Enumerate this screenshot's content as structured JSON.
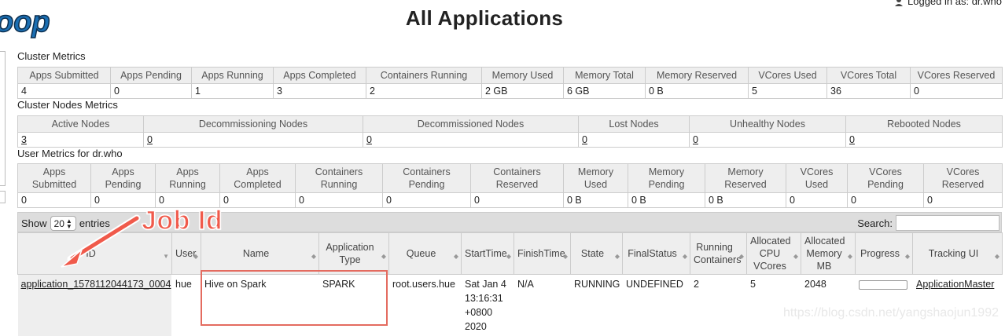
{
  "header": {
    "logo_text": "oop",
    "title": "All Applications",
    "logged_in": "Logged in as: dr.who"
  },
  "cluster_metrics": {
    "title": "Cluster Metrics",
    "headers": [
      "Apps Submitted",
      "Apps Pending",
      "Apps Running",
      "Apps Completed",
      "Containers Running",
      "Memory Used",
      "Memory Total",
      "Memory Reserved",
      "VCores Used",
      "VCores Total",
      "VCores Reserved"
    ],
    "values": [
      "4",
      "0",
      "1",
      "3",
      "2",
      "2 GB",
      "6 GB",
      "0 B",
      "5",
      "36",
      "0"
    ]
  },
  "cluster_nodes_metrics": {
    "title": "Cluster Nodes Metrics",
    "headers": [
      "Active Nodes",
      "Decommissioning Nodes",
      "Decommissioned Nodes",
      "Lost Nodes",
      "Unhealthy Nodes",
      "Rebooted Nodes"
    ],
    "values": [
      "3",
      "0",
      "0",
      "0",
      "0",
      "0"
    ]
  },
  "user_metrics": {
    "title": "User Metrics for dr.who",
    "headers": [
      "Apps Submitted",
      "Apps Pending",
      "Apps Running",
      "Apps Completed",
      "Containers Running",
      "Containers Pending",
      "Containers Reserved",
      "Memory Used",
      "Memory Pending",
      "Memory Reserved",
      "VCores Used",
      "VCores Pending",
      "VCores Reserved"
    ],
    "values": [
      "0",
      "0",
      "0",
      "0",
      "0",
      "0",
      "0",
      "0 B",
      "0 B",
      "0 B",
      "0",
      "0",
      "0"
    ]
  },
  "toolbar": {
    "show_label": "Show",
    "entries_value": "20",
    "entries_label": "entries",
    "search_label": "Search:",
    "search_value": ""
  },
  "apps_table": {
    "headers": [
      "ID",
      "User",
      "Name",
      "Application Type",
      "Queue",
      "StartTime",
      "FinishTime",
      "State",
      "FinalStatus",
      "Running Containers",
      "Allocated CPU VCores",
      "Allocated Memory MB",
      "Progress",
      "Tracking UI"
    ],
    "row": {
      "id": "application_1578112044173_0004",
      "user": "hue",
      "name": "Hive on Spark",
      "type": "SPARK",
      "queue": "root.users.hue",
      "start_time": "Sat Jan 4 13:16:31 +0800 2020",
      "finish_time": "N/A",
      "state": "RUNNING",
      "final_status": "UNDEFINED",
      "running_containers": "2",
      "allocated_vcores": "5",
      "allocated_memory": "2048",
      "progress": 0,
      "tracking_ui": "ApplicationMaster"
    }
  },
  "annotation": {
    "label": "Job Id",
    "color": "#f05a4b"
  },
  "watermark": "https://blog.csdn.net/yangshaojun1992"
}
